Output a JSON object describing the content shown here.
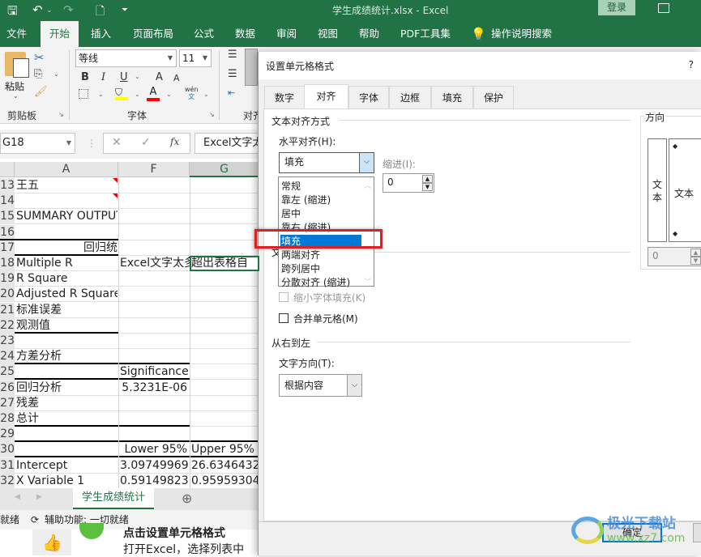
{
  "titlebar": {
    "title": "学生成绩统计.xlsx  -  Excel",
    "login": "登录",
    "qat_more": "⏷"
  },
  "menu": [
    "文件",
    "开始",
    "插入",
    "页面布局",
    "公式",
    "数据",
    "审阅",
    "视图",
    "帮助",
    "PDF工具集",
    "操作说明搜索"
  ],
  "ribbon": {
    "paste": "粘贴",
    "clipboard_label": "剪贴板",
    "font_name": "等线",
    "font_size": "11",
    "font_label": "字体",
    "align_label": "对齐",
    "bold": "B",
    "italic": "I",
    "underline": "U",
    "grow": "A",
    "shrink": "A",
    "fontcolor": "A",
    "phonetic": "wén\n文"
  },
  "formula": {
    "name_box": "G18",
    "content": "Excel文字太多超出表格自",
    "fx": "fx"
  },
  "sheet": {
    "columns": [
      "A",
      "F",
      "G"
    ],
    "rows": [
      {
        "n": "13",
        "a": "王五",
        "f": "",
        "g": ""
      },
      {
        "n": "14",
        "a": "",
        "f": "",
        "g": ""
      },
      {
        "n": "15",
        "a": "SUMMARY OUTPUT",
        "f": "",
        "g": ""
      },
      {
        "n": "16",
        "a": "",
        "f": "",
        "g": ""
      },
      {
        "n": "17",
        "a": "回归统",
        "f": "",
        "g": ""
      },
      {
        "n": "18",
        "a": "Multiple R",
        "f": "Excel文字太多",
        "g": "超出表格自"
      },
      {
        "n": "19",
        "a": "R Square",
        "f": "",
        "g": ""
      },
      {
        "n": "20",
        "a": "Adjusted R Square",
        "f": "",
        "g": ""
      },
      {
        "n": "21",
        "a": "标准误差",
        "f": "",
        "g": ""
      },
      {
        "n": "22",
        "a": "观测值",
        "f": "",
        "g": ""
      },
      {
        "n": "23",
        "a": "",
        "f": "",
        "g": ""
      },
      {
        "n": "24",
        "a": "方差分析",
        "f": "",
        "g": ""
      },
      {
        "n": "25",
        "a": "",
        "f": "Significance F",
        "g": ""
      },
      {
        "n": "26",
        "a": "回归分析",
        "f": "5.3231E-06",
        "g": ""
      },
      {
        "n": "27",
        "a": "残差",
        "f": "",
        "g": ""
      },
      {
        "n": "28",
        "a": "总计",
        "f": "",
        "g": ""
      },
      {
        "n": "29",
        "a": "",
        "f": "",
        "g": ""
      },
      {
        "n": "30",
        "a": "",
        "f": "Lower 95%",
        "g": "Upper 95%"
      },
      {
        "n": "31",
        "a": "Intercept",
        "f": "3.09749969",
        "g": "26.6346432"
      },
      {
        "n": "32",
        "a": "X Variable 1",
        "f": "0.59149823",
        "g": "0.95959304"
      }
    ],
    "tab_name": "学生成绩统计",
    "status": "就绪",
    "accessibility": "辅助功能: 一切就绪"
  },
  "background_article": {
    "heading": "点击设置单元格格式",
    "body": "打开Excel，选择列表中"
  },
  "dialog": {
    "title": "设置单元格格式",
    "help": "?",
    "tabs": [
      "数字",
      "对齐",
      "字体",
      "边框",
      "填充",
      "保护"
    ],
    "active_tab": "对齐",
    "section_text_align": "文本对齐方式",
    "horizontal_label": "水平对齐(H):",
    "horizontal_value": "填充",
    "indent_label": "缩进(I):",
    "indent_value": "0",
    "horizontal_options": [
      "常规",
      "靠左 (缩进)",
      "居中",
      "靠右 (缩进)",
      "填充",
      "两端对齐",
      "跨列居中",
      "分散对齐 (缩进)"
    ],
    "selected_option": "填充",
    "vertical_label_partial": "文",
    "shrink_to_fit": {
      "label": "缩小字体填充(K)",
      "checked": false,
      "disabled": true
    },
    "merge_cells": {
      "label": "合并单元格(M)",
      "checked": false
    },
    "section_rtl": "从右到左",
    "text_direction_label": "文字方向(T):",
    "text_direction_value": "根据内容",
    "orientation_label": "方向",
    "orientation_vertical_text": "文\n本",
    "orientation_text": "文本",
    "orientation_degrees": "0",
    "ok": "确定"
  },
  "watermark": {
    "text": "极光下载站",
    "url_text": "www.xz7.com"
  }
}
